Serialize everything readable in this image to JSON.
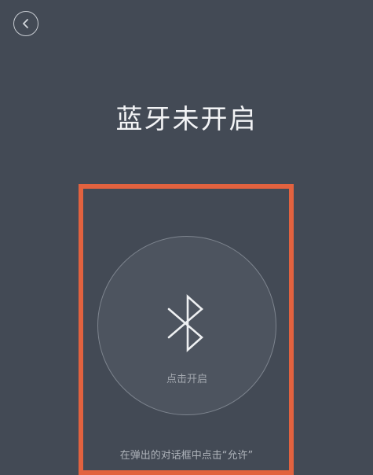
{
  "header": {
    "back_icon": "chevron-left-icon"
  },
  "main": {
    "title": "蓝牙未开启",
    "bluetooth_icon": "bluetooth-icon",
    "open_label": "点击开启",
    "hint": "在弹出的对话框中点击“允许”"
  },
  "colors": {
    "background": "#434a55",
    "highlight_border": "#e2623f",
    "circle_fill": "#4d545f"
  }
}
